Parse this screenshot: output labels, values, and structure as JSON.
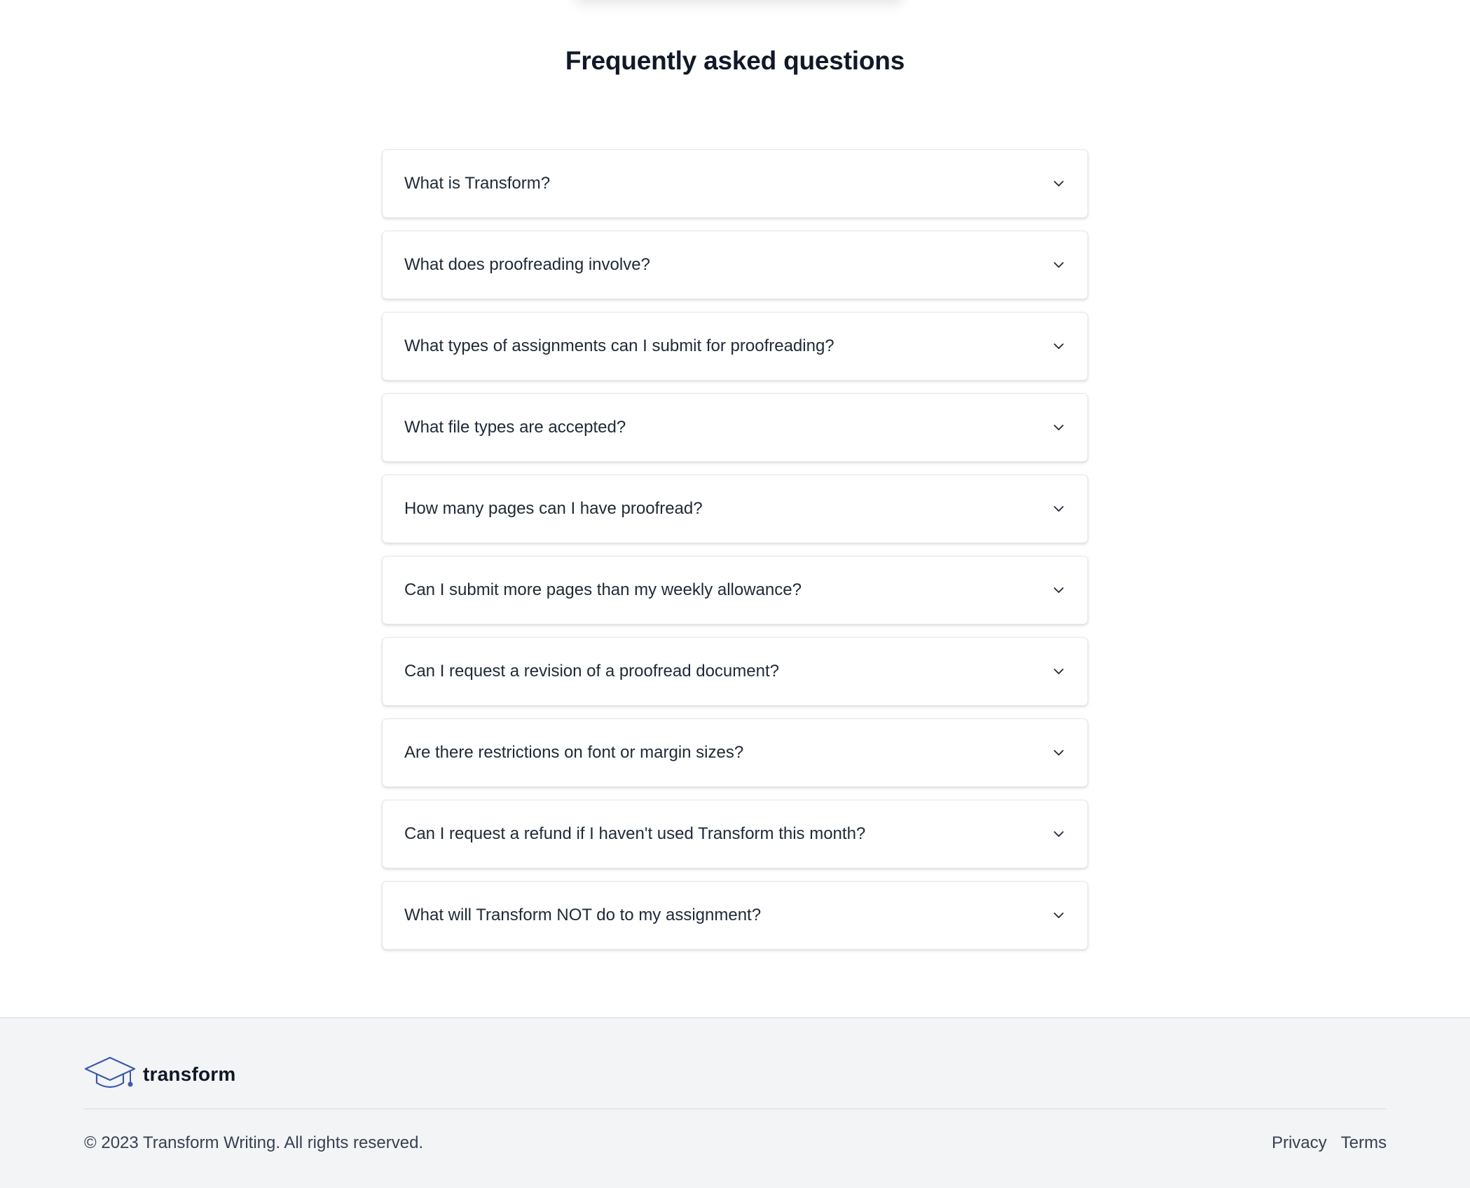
{
  "faq": {
    "title": "Frequently asked questions",
    "items": [
      {
        "question": "What is Transform?"
      },
      {
        "question": "What does proofreading involve?"
      },
      {
        "question": "What types of assignments can I submit for proofreading?"
      },
      {
        "question": "What file types are accepted?"
      },
      {
        "question": "How many pages can I have proofread?"
      },
      {
        "question": "Can I submit more pages than my weekly allowance?"
      },
      {
        "question": "Can I request a revision of a proofread document?"
      },
      {
        "question": "Are there restrictions on font or margin sizes?"
      },
      {
        "question": "Can I request a refund if I haven't used Transform this month?"
      },
      {
        "question": "What will Transform NOT do to my assignment?"
      }
    ],
    "chevron_icon": "chevron-down-icon"
  },
  "footer": {
    "logo_text": "transform",
    "logo_icon": "graduation-cap-icon",
    "copyright": "© 2023 Transform Writing. All rights reserved.",
    "links": [
      {
        "label": "Privacy"
      },
      {
        "label": "Terms"
      }
    ]
  },
  "colors": {
    "text": "#1f2937",
    "heading": "#111827",
    "footer_bg": "#f3f4f6",
    "border": "#e5e7eb",
    "logo_blue": "#3b5bab"
  }
}
